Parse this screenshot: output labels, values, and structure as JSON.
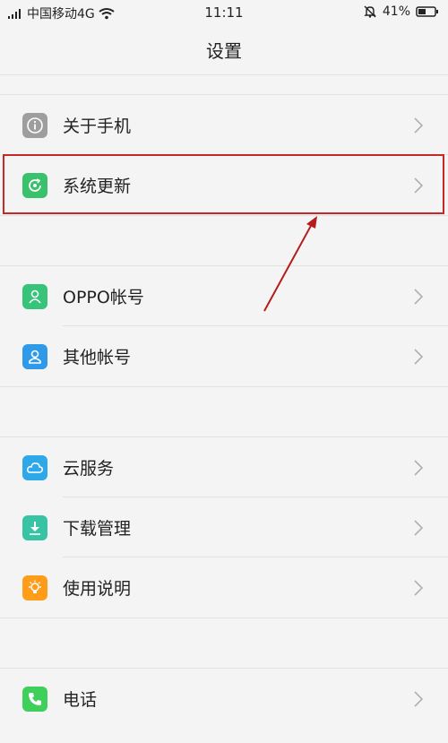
{
  "status": {
    "carrier": "中国移动4G",
    "time": "11:11",
    "battery": "41%",
    "icons": [
      "signal-icon",
      "wifi-icon",
      "mute-bell-icon",
      "battery-icon"
    ]
  },
  "header": {
    "title": "设置"
  },
  "groups": [
    {
      "items": [
        {
          "label": "关于手机",
          "icon": "info-icon",
          "color": "#9e9e9e"
        },
        {
          "label": "系统更新",
          "icon": "system-update-icon",
          "color": "#39c16c"
        }
      ]
    },
    {
      "items": [
        {
          "label": "OPPO帐号",
          "icon": "oppo-account-icon",
          "color": "#37c47a"
        },
        {
          "label": "其他帐号",
          "icon": "other-accounts-icon",
          "color": "#2f9ae8"
        }
      ]
    },
    {
      "items": [
        {
          "label": "云服务",
          "icon": "cloud-service-icon",
          "color": "#2ea8e8"
        },
        {
          "label": "下载管理",
          "icon": "download-manager-icon",
          "color": "#38c3a5"
        },
        {
          "label": "使用说明",
          "icon": "user-guide-icon",
          "color": "#ff9c19"
        }
      ]
    },
    {
      "items": [
        {
          "label": "电话",
          "icon": "phone-icon",
          "color": "#3fd05b"
        }
      ]
    }
  ],
  "annotation": {
    "highlight_color": "#c62828"
  }
}
